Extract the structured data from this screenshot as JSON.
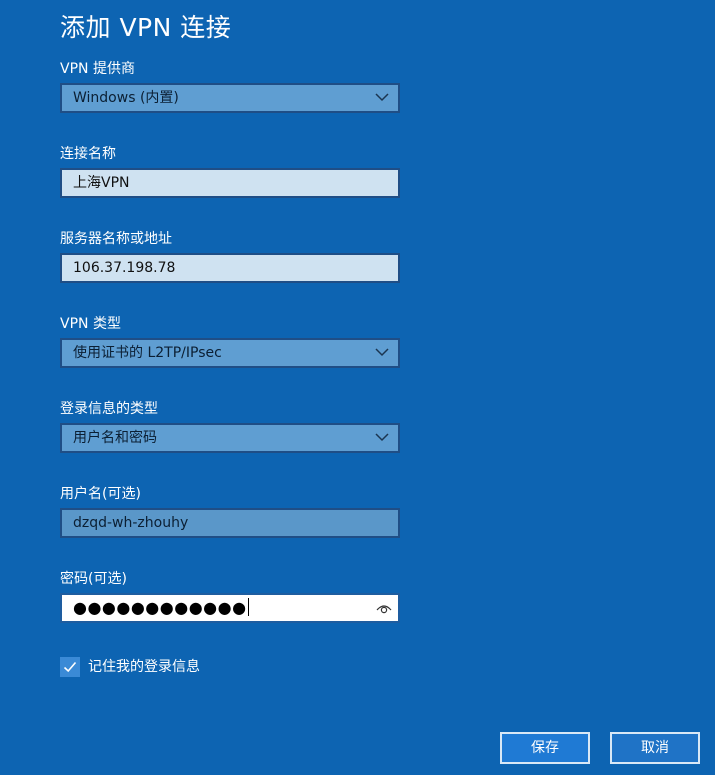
{
  "dialog": {
    "title": "添加 VPN 连接"
  },
  "fields": {
    "provider": {
      "label": "VPN 提供商",
      "value": "Windows (内置)"
    },
    "connection_name": {
      "label": "连接名称",
      "value": "上海VPN"
    },
    "server": {
      "label": "服务器名称或地址",
      "value": "106.37.198.78"
    },
    "vpn_type": {
      "label": "VPN 类型",
      "value": "使用证书的 L2TP/IPsec"
    },
    "signin_type": {
      "label": "登录信息的类型",
      "value": "用户名和密码"
    },
    "username": {
      "label": "用户名(可选)",
      "value": "dzqd-wh-zhouhy"
    },
    "password": {
      "label": "密码(可选)",
      "masked_value": "●●●●●●●●●●●●"
    }
  },
  "remember": {
    "label": "记住我的登录信息",
    "checked": true
  },
  "buttons": {
    "save": "保存",
    "cancel": "取消"
  },
  "icons": {
    "dropdown": "chevron-down-icon",
    "reveal": "eye-icon",
    "check": "checkmark-icon"
  },
  "colors": {
    "background": "#0d64b2",
    "accent": "#1f7ad4"
  }
}
